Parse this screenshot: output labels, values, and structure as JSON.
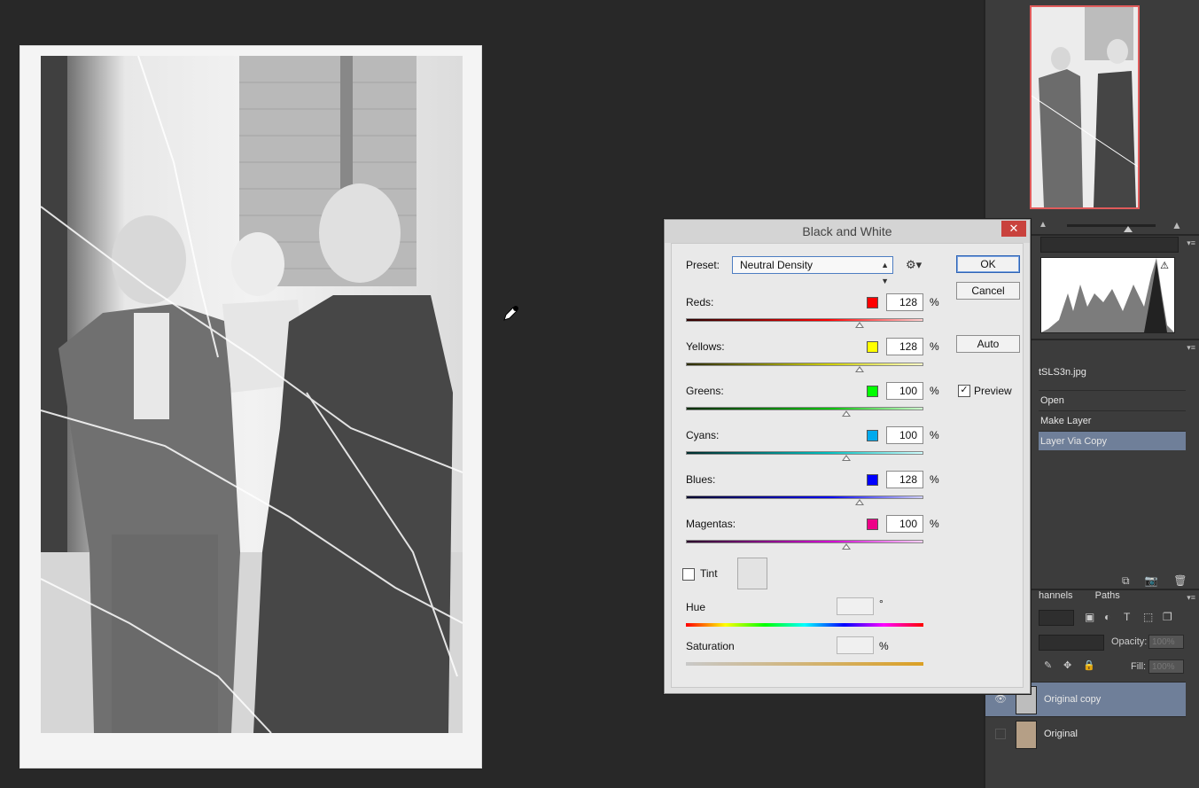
{
  "dialog": {
    "title": "Black and White",
    "close_glyph": "✕",
    "preset_label": "Preset:",
    "preset_value": "Neutral Density",
    "buttons": {
      "ok": "OK",
      "cancel": "Cancel",
      "auto": "Auto"
    },
    "preview_label": "Preview",
    "preview_checked": true,
    "sliders": [
      {
        "label": "Reds:",
        "value": "128",
        "unit": "%",
        "color": "#ff0000",
        "gradient": [
          "#2a0000",
          "#ff0000",
          "#ffd0d0"
        ]
      },
      {
        "label": "Yellows:",
        "value": "128",
        "unit": "%",
        "color": "#ffff00",
        "gradient": [
          "#2a2a00",
          "#cccc00",
          "#ffffc8"
        ]
      },
      {
        "label": "Greens:",
        "value": "100",
        "unit": "%",
        "color": "#00ff00",
        "gradient": [
          "#002a00",
          "#00c000",
          "#d0ffd0"
        ]
      },
      {
        "label": "Cyans:",
        "value": "100",
        "unit": "%",
        "color": "#00aaee",
        "gradient": [
          "#002a2a",
          "#00c0c0",
          "#d0ffff"
        ]
      },
      {
        "label": "Blues:",
        "value": "128",
        "unit": "%",
        "color": "#0000ff",
        "gradient": [
          "#00002a",
          "#0000ee",
          "#d0d0ff"
        ]
      },
      {
        "label": "Magentas:",
        "value": "100",
        "unit": "%",
        "color": "#ee0088",
        "gradient": [
          "#2a002a",
          "#d000d0",
          "#ffd0ff"
        ]
      }
    ],
    "tint_label": "Tint",
    "tint_checked": false,
    "hue_label": "Hue",
    "hue_unit": "°",
    "saturation_label": "Saturation",
    "saturation_unit": "%"
  },
  "history": {
    "document": "tSLS3n.jpg",
    "steps": [
      {
        "label": "Open",
        "active": false
      },
      {
        "label": "Make Layer",
        "active": false
      },
      {
        "label": "Layer Via Copy",
        "active": true
      }
    ]
  },
  "layers_panel": {
    "tabs": [
      "hannels",
      "Paths"
    ],
    "opacity_label": "Opacity:",
    "opacity_value": "100%",
    "fill_label": "Fill:",
    "fill_value": "100%",
    "layers": [
      {
        "name": "Original copy",
        "visible": true,
        "active": true
      },
      {
        "name": "Original",
        "visible": false,
        "active": false
      }
    ]
  },
  "icons": {
    "eye": "👁",
    "gear": "⚙",
    "trash": "🗑",
    "camera": "📷",
    "checkmark": "✓"
  }
}
